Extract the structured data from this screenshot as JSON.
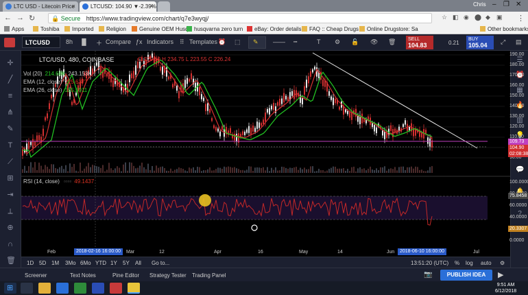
{
  "browser": {
    "tabs": [
      {
        "label": "LTC USD - Litecoin Price"
      },
      {
        "label": "LTCUSD: 104.90 ▼-2.39%"
      }
    ],
    "profile": "Chris",
    "address_secure": "Secure",
    "address_url": "https://www.tradingview.com/chart/q7e3wyqj/",
    "bookmarks": [
      "Apps",
      "Toshiba",
      "Imported",
      "Religion",
      "Genuine OEM Husq",
      "husqvarna zero turn",
      "eBay: Order details",
      "FAQ :: Cheap Drugs",
      "Online Drugstore: Sa",
      "Other bookmarks"
    ]
  },
  "toolbar": {
    "symbol": "LTCUSD",
    "interval": "8h",
    "compare": "Compare",
    "indicators": "Indicators",
    "templates": "Templates",
    "sell_label": "SELL",
    "sell_price": "104.83",
    "spread": "0.21",
    "buy_label": "BUY",
    "buy_price": "105.04"
  },
  "chart": {
    "legend_title": "LTC/USD, 480, COINBASE",
    "legend_ohlc": "O 229.69 H 234.75 L 223.55 C 226.24",
    "vol_label": "Vol (20)",
    "vol_val1": "214.68K",
    "vol_val2": "243.153K",
    "ema12_label": "EMA (12, close)",
    "ema12_val": "225.6377",
    "ema26_label": "EMA (26, close)",
    "ema26_val": "185.5911",
    "rsi_label": "RSI (14, close)",
    "rsi_val": "49.1437",
    "price_axis": [
      "190.00",
      "180.00",
      "170.00",
      "160.00",
      "150.00",
      "140.00",
      "130.00",
      "120.00",
      "110.00",
      "100.00",
      "90.00"
    ],
    "price_tags": {
      "ema": "109.73",
      "last": "104.90",
      "countdown": "02:08:38"
    },
    "rsi_axis": [
      "100.0000",
      "80.0000",
      "60.0000",
      "40.0000",
      "20.0000",
      "0.0000"
    ],
    "rsi_tags": {
      "upper": "75.8458",
      "lower": "20.3307"
    },
    "time_labels": [
      "Feb",
      "Mar",
      "12",
      "Apr",
      "16",
      "May",
      "14",
      "Jun",
      "Jul"
    ],
    "time_tag_left": "2018-02-16 16:00:00",
    "time_tag_right": "2018-06-10 16:00:00",
    "colors": {
      "bg": "#000000",
      "candle": "#d23030",
      "ema_fast": "#d23030",
      "ema_slow": "#22c022",
      "rsi": "#c52828",
      "trend": "#e8e8e8",
      "level": "#c040c0"
    }
  },
  "timebar": {
    "ranges": [
      "1D",
      "5D",
      "1M",
      "3Mo",
      "6Mo",
      "YTD",
      "1Y",
      "5Y",
      "All"
    ],
    "goto": "Go to...",
    "clock": "13:51:20 (UTC)",
    "pct": "%",
    "log": "log",
    "auto": "auto"
  },
  "panels": [
    "Screener",
    "Text Notes",
    "Pine Editor",
    "Strategy Tester",
    "Trading Panel"
  ],
  "publish": "PUBLISH IDEA",
  "taskbar": {
    "time": "9:51 AM",
    "date": "6/12/2018"
  }
}
